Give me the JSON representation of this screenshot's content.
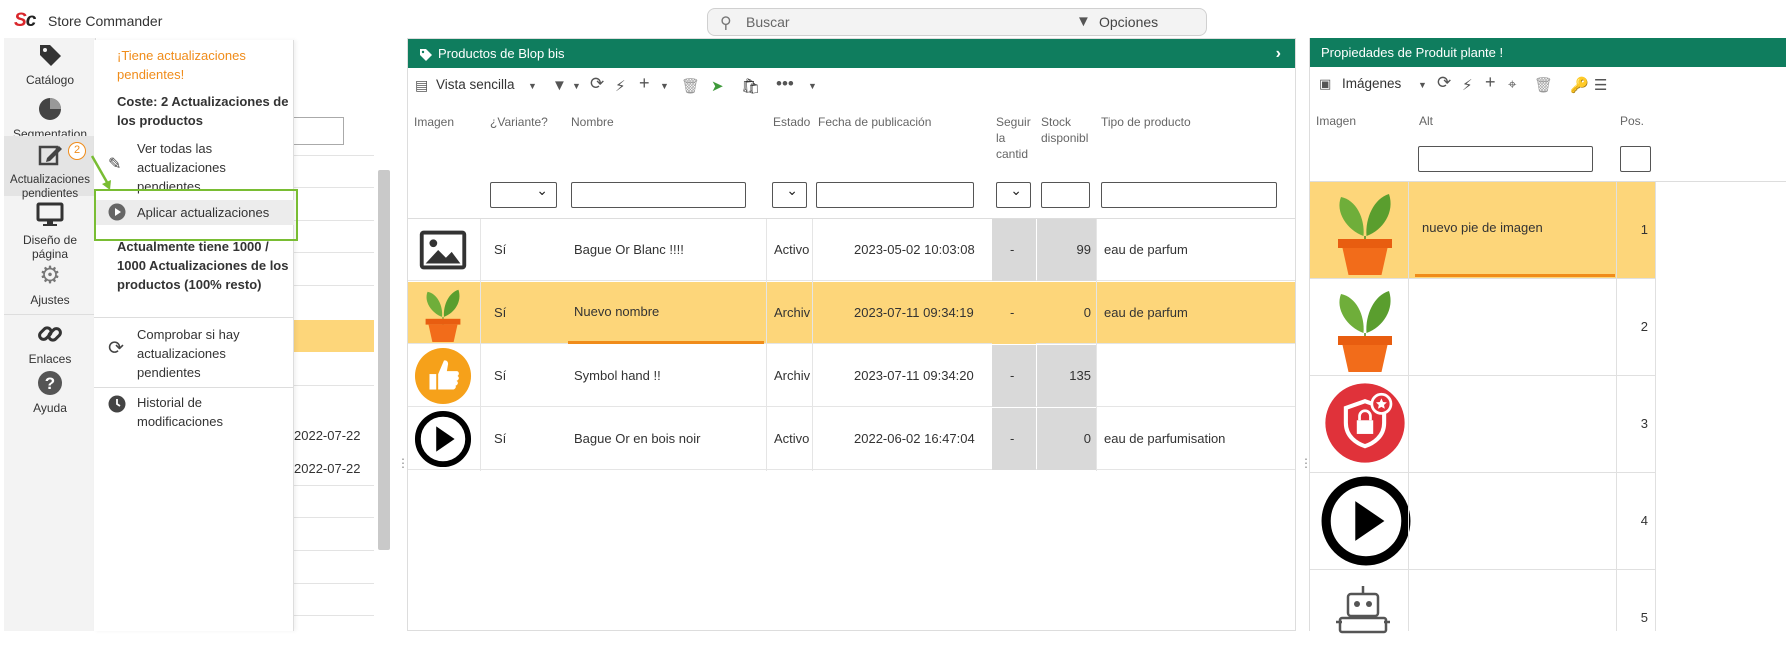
{
  "app": {
    "title": "Store Commander",
    "logo_text": "Sc"
  },
  "search": {
    "placeholder": "Buscar",
    "options_label": "Opciones"
  },
  "nav": [
    {
      "label": "Catálogo"
    },
    {
      "label": "Segmentation"
    },
    {
      "label": "Actualizaciones pendientes",
      "badge": "2"
    },
    {
      "label": "Diseño de página"
    },
    {
      "label": "Ajustes"
    },
    {
      "label": "Enlaces"
    },
    {
      "label": "Ayuda"
    }
  ],
  "popup": {
    "pending_title": "¡Tiene actualizaciones pendientes!",
    "cost_title": "Coste: 2 Actualizaciones de los productos",
    "view_all": "Ver todas las actualizaciones pendientes",
    "apply": "Aplicar actualizaciones",
    "current": "Actualmente tiene 1000 / 1000 Actualizaciones de los productos (100% resto)",
    "check": "Comprobar si hay actualizaciones pendientes",
    "history": "Historial de modificaciones"
  },
  "background_dates": [
    "2022-07-22",
    "2022-07-22"
  ],
  "products": {
    "title": "Productos de Blop bis",
    "view_label": "Vista sencilla",
    "columns": [
      "Imagen",
      "¿Variante?",
      "Nombre",
      "Estado",
      "Fecha de publicación",
      "Seguir la cantid",
      "Stock disponibl",
      "Tipo de producto"
    ],
    "rows": [
      {
        "variant": "Sí",
        "name": "Bague Or Blanc !!!!",
        "status": "Activo",
        "date": "2023-05-02 10:03:08",
        "follow": "-",
        "stock": "99",
        "type": "eau de parfum",
        "image": "image-placeholder-icon"
      },
      {
        "variant": "Sí",
        "name": "Nuevo nombre",
        "status": "Archiv",
        "date": "2023-07-11 09:34:19",
        "follow": "-",
        "stock": "0",
        "type": "eau de parfum",
        "image": "plant-pot-icon"
      },
      {
        "variant": "Sí",
        "name": "Symbol hand !!",
        "status": "Archiv",
        "date": "2023-07-11 09:34:20",
        "follow": "-",
        "stock": "135",
        "type": "",
        "image": "thumbs-up-icon"
      },
      {
        "variant": "Sí",
        "name": "Bague Or en bois noir",
        "status": "Activo",
        "date": "2022-06-02 16:47:04",
        "follow": "-",
        "stock": "0",
        "type": "eau de parfumisation",
        "image": "play-icon"
      }
    ]
  },
  "properties": {
    "title": "Propiedades de Produit plante !",
    "view_label": "Imágenes",
    "columns": [
      "Imagen",
      "Alt",
      "Pos."
    ],
    "rows": [
      {
        "alt": "nuevo pie de imagen",
        "pos": "1",
        "image": "plant-pot-icon"
      },
      {
        "alt": "",
        "pos": "2",
        "image": "plant-pot-icon"
      },
      {
        "alt": "",
        "pos": "3",
        "image": "security-shield-icon"
      },
      {
        "alt": "",
        "pos": "4",
        "image": "play-icon"
      },
      {
        "alt": "",
        "pos": "5",
        "image": "robot-icon"
      }
    ]
  },
  "colors": {
    "header_green": "#0f7d5e",
    "selected_row": "#fdd67a",
    "accent_orange": "#f08c1a",
    "highlight_green": "#79bd33"
  }
}
